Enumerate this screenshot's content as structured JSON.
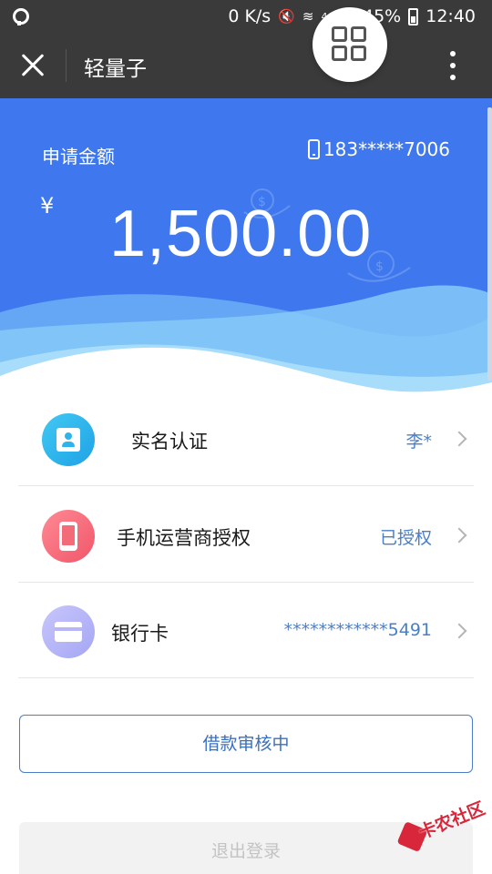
{
  "status_bar": {
    "network_speed": "0 K/s",
    "network_type": "4G",
    "battery": "45%",
    "time": "12:40",
    "icons": [
      "mute-icon",
      "wifi-icon",
      "signal-icon",
      "battery-icon"
    ]
  },
  "title_bar": {
    "title": "轻量子",
    "icons": [
      "close-icon",
      "grid-icon",
      "more-vertical-icon"
    ]
  },
  "banner": {
    "amount_label": "申请金额",
    "phone": "183*****7006",
    "currency_symbol": "¥",
    "amount": "1,500.00",
    "color": "#3f78ee"
  },
  "list": {
    "items": [
      {
        "label": "实名认证",
        "value": "李*",
        "icon": "id-card-icon"
      },
      {
        "label": "手机运营商授权",
        "value": "已授权",
        "icon": "mobile-phone-icon"
      },
      {
        "label": "银行卡",
        "value": "************5491",
        "icon": "bank-card-icon"
      }
    ]
  },
  "actions": {
    "primary_label": "借款审核中",
    "logout_label": "退出登录"
  },
  "watermark": {
    "text": "卡农社区"
  }
}
